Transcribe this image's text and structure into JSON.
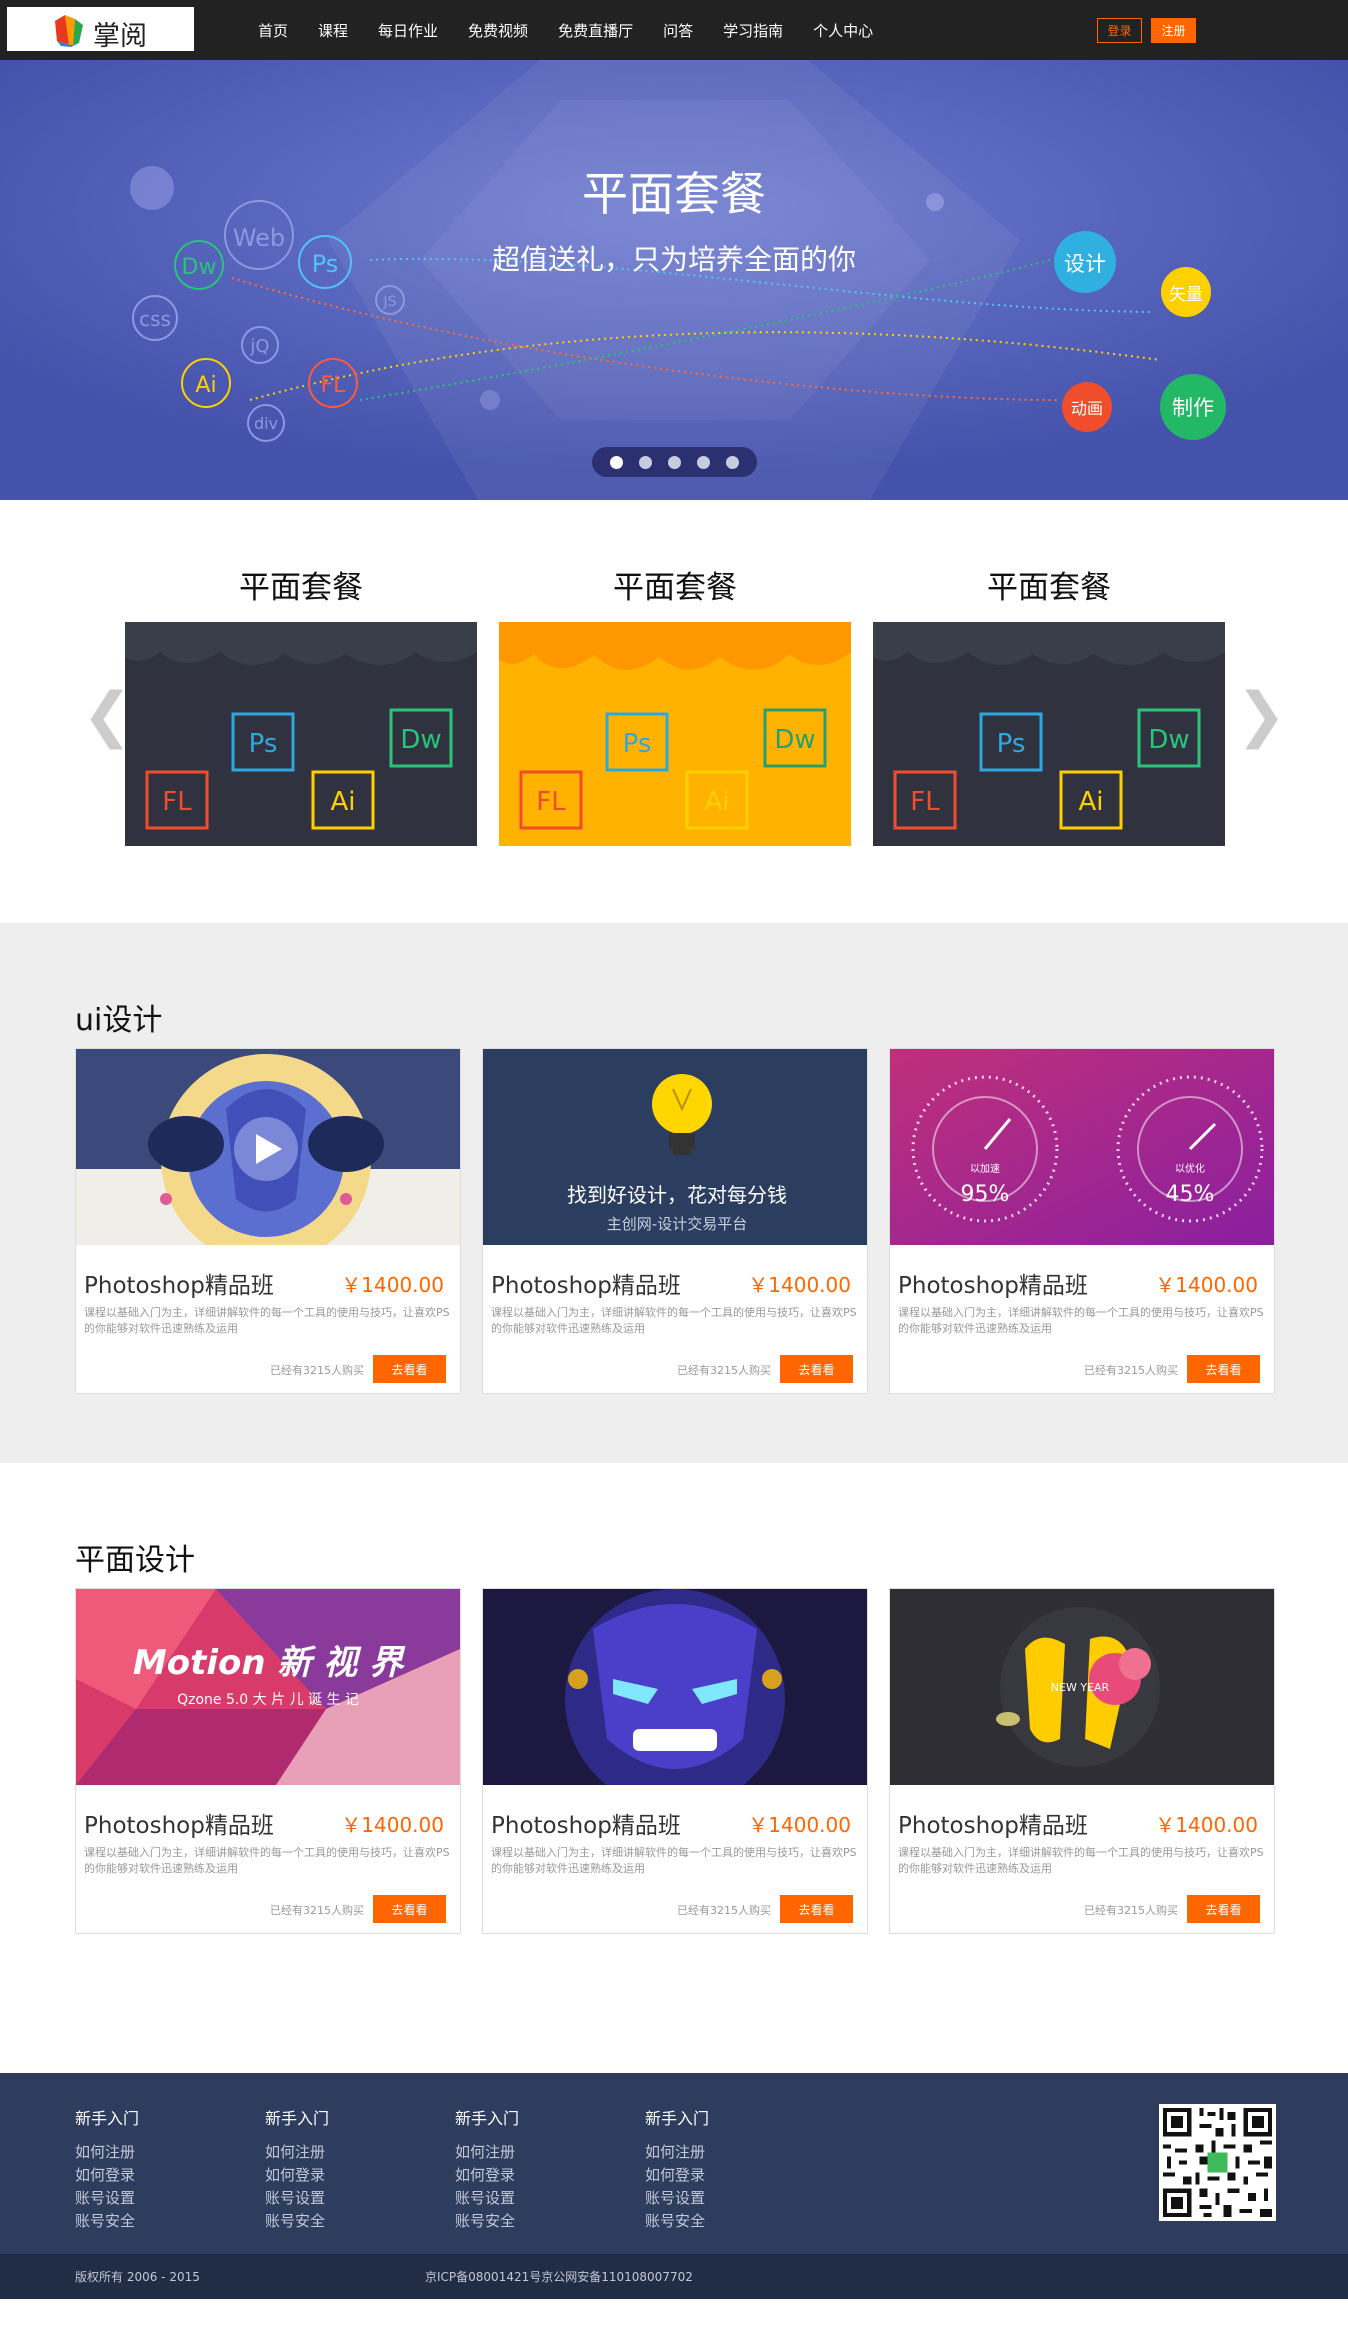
{
  "header": {
    "logo_text": "掌阅",
    "nav": [
      "首页",
      "课程",
      "每日作业",
      "免费视频",
      "免费直播厅",
      "问答",
      "学习指南",
      "个人中心"
    ],
    "login": "登录",
    "register": "注册",
    "accent": "#ff6600"
  },
  "banner": {
    "title": "平面套餐",
    "subtitle": "超值送礼，只为培养全面的你",
    "left_tags": [
      "Web",
      "Dw",
      "Ps",
      "css",
      "JS",
      "jQ",
      "Ai",
      "FL",
      "div"
    ],
    "right_tags": [
      "设计",
      "矢量",
      "动画",
      "制作"
    ],
    "slide_count": 5,
    "active_slide": 1
  },
  "packages": {
    "items": [
      {
        "title": "平面套餐",
        "icons": [
          "Ps",
          "Dw",
          "FL",
          "Ai"
        ]
      },
      {
        "title": "平面套餐",
        "icons": [
          "Ps",
          "Dw",
          "FL",
          "Ai"
        ]
      },
      {
        "title": "平面套餐",
        "icons": [
          "Ps",
          "Dw",
          "FL",
          "Ai"
        ]
      }
    ],
    "prev": "❮",
    "next": "❯"
  },
  "ui_section": {
    "title": "ui设计",
    "cards": [
      {
        "name": "Photoshop精品班",
        "price": "￥1400.00",
        "desc": "课程以基础入门为主，详细讲解软件的每一个工具的使用与技巧，让喜欢PS的你能够对软件迅速熟练及运用",
        "sold": "已经有3215人购买",
        "button": "去看看"
      },
      {
        "name": "Photoshop精品班",
        "price": "￥1400.00",
        "desc": "课程以基础入门为主，详细讲解软件的每一个工具的使用与技巧，让喜欢PS的你能够对软件迅速熟练及运用",
        "sold": "已经有3215人购买",
        "button": "去看看",
        "img_line1": "找到好设计，花对每分钱",
        "img_line2": "主创网-设计交易平台"
      },
      {
        "name": "Photoshop精品班",
        "price": "￥1400.00",
        "desc": "课程以基础入门为主，详细讲解软件的每一个工具的使用与技巧，让喜欢PS的你能够对软件迅速熟练及运用",
        "sold": "已经有3215人购买",
        "button": "去看看",
        "gauge1": "95%",
        "gauge2": "45%",
        "gauge1_label": "以加速",
        "gauge2_label": "以优化"
      }
    ]
  },
  "graphic_section": {
    "title": "平面设计",
    "cards": [
      {
        "name": "Photoshop精品班",
        "price": "￥1400.00",
        "desc": "课程以基础入门为主，详细讲解软件的每一个工具的使用与技巧，让喜欢PS的你能够对软件迅速熟练及运用",
        "sold": "已经有3215人购买",
        "button": "去看看",
        "img_line1": "Motion 新 视 界",
        "img_line2": "Qzone 5.0 大 片 儿 诞 生 记"
      },
      {
        "name": "Photoshop精品班",
        "price": "￥1400.00",
        "desc": "课程以基础入门为主，详细讲解软件的每一个工具的使用与技巧，让喜欢PS的你能够对软件迅速熟练及运用",
        "sold": "已经有3215人购买",
        "button": "去看看"
      },
      {
        "name": "Photoshop精品班",
        "price": "￥1400.00",
        "desc": "课程以基础入门为主，详细讲解软件的每一个工具的使用与技巧，让喜欢PS的你能够对软件迅速熟练及运用",
        "sold": "已经有3215人购买",
        "button": "去看看",
        "img_line1": "NEW YEAR"
      }
    ]
  },
  "footer": {
    "columns": [
      {
        "head": "新手入门",
        "links": [
          "如何注册",
          "如何登录",
          "账号设置",
          "账号安全"
        ]
      },
      {
        "head": "新手入门",
        "links": [
          "如何注册",
          "如何登录",
          "账号设置",
          "账号安全"
        ]
      },
      {
        "head": "新手入门",
        "links": [
          "如何注册",
          "如何登录",
          "账号设置",
          "账号安全"
        ]
      },
      {
        "head": "新手入门",
        "links": [
          "如何注册",
          "如何登录",
          "账号设置",
          "账号安全"
        ]
      }
    ],
    "copyright": "版权所有 2006 - 2015",
    "icp": "京ICP备08001421号京公网安备110108007702"
  }
}
